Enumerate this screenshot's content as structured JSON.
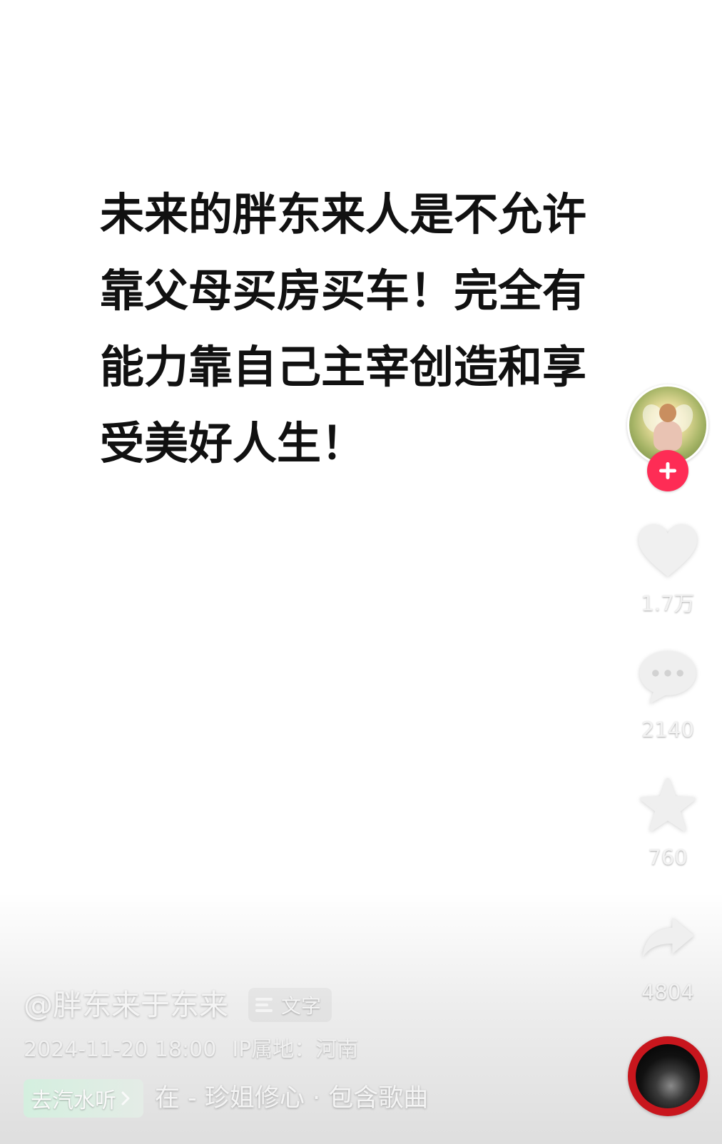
{
  "post": {
    "text_lines": [
      "未来的胖东来人是不允许",
      "靠父母买房买车！完全有",
      "能力靠自己主宰创造和享",
      "受美好人生！"
    ]
  },
  "sidebar": {
    "follow_icon": "plus-icon",
    "like_icon": "heart-icon",
    "like_count": "1.7万",
    "comment_icon": "comment-bubble-icon",
    "comment_count": "2140",
    "favorite_icon": "star-icon",
    "favorite_count": "760",
    "share_icon": "share-arrow-icon",
    "share_count": "4804"
  },
  "author": {
    "handle": "@胖东来于东来",
    "tag_icon": "text-lines-icon",
    "tag_label": "文字"
  },
  "meta": {
    "date": "2024-11-20 18:00",
    "ip_location": "IP属地：河南"
  },
  "music": {
    "cta_label": "去汽水听",
    "cta_icon": "chevron-right-icon",
    "track_text": "在 - 珍姐修心 · 包含歌曲"
  },
  "colors": {
    "follow_accent": "#fe2c55",
    "disc_ring": "#c8161d",
    "text_primary": "#111111"
  }
}
